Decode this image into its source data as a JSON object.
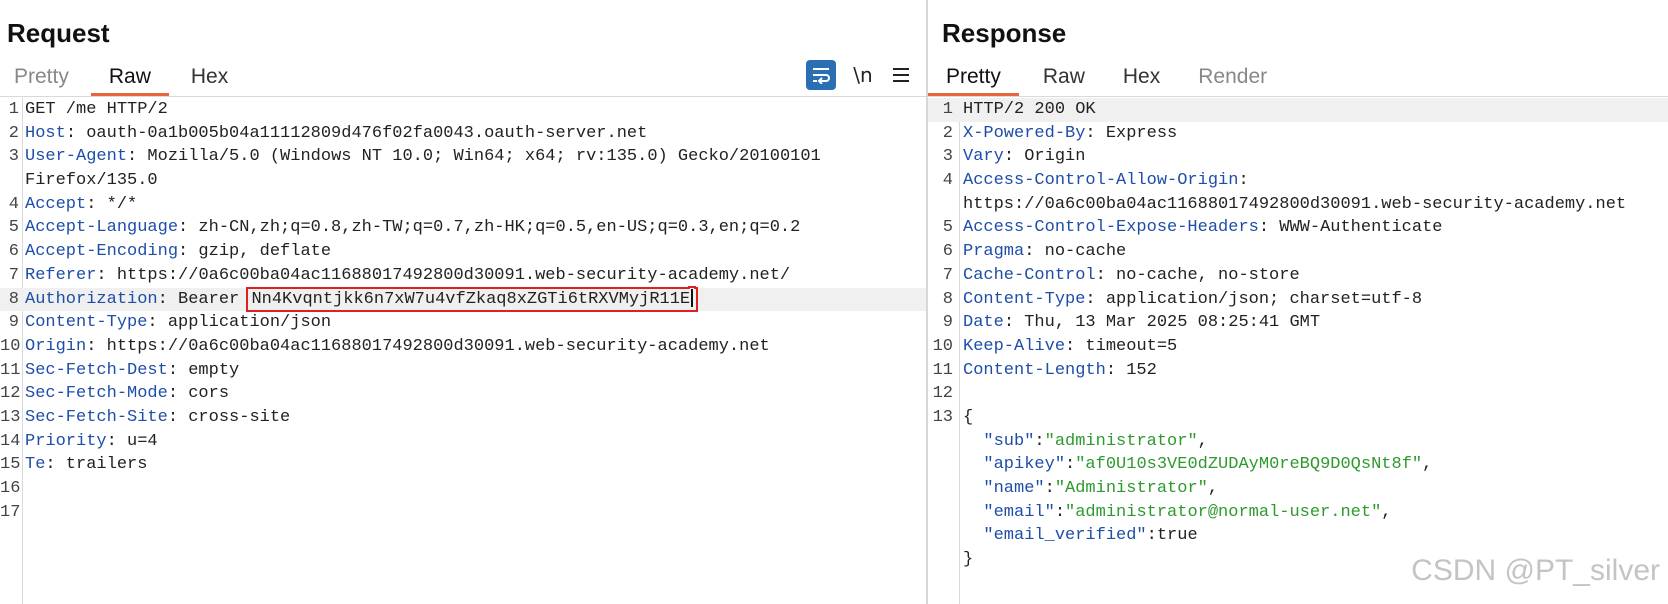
{
  "request": {
    "title": "Request",
    "tabs": [
      {
        "label": "Pretty",
        "active": false
      },
      {
        "label": "Raw",
        "active": true
      },
      {
        "label": "Hex",
        "active": false
      }
    ],
    "toolbar": {
      "wrap_icon": "word-wrap-icon",
      "newline_label": "\\n",
      "menu_icon": "hamburger-menu-icon"
    },
    "lines": [
      {
        "n": "1",
        "parts": [
          {
            "t": "GET /me HTTP/2",
            "c": "hval"
          }
        ]
      },
      {
        "n": "2",
        "parts": [
          {
            "t": "Host",
            "c": "hname"
          },
          {
            "t": ": oauth-0a1b005b04a11112809d476f02fa0043.oauth-server.net",
            "c": "hval"
          }
        ]
      },
      {
        "n": "3",
        "parts": [
          {
            "t": "User-Agent",
            "c": "hname"
          },
          {
            "t": ": Mozilla/5.0 (Windows NT 10.0; Win64; x64; rv:135.0) Gecko/20100101",
            "c": "hval"
          }
        ]
      },
      {
        "n": "",
        "parts": [
          {
            "t": "Firefox/135.0",
            "c": "hval"
          }
        ]
      },
      {
        "n": "4",
        "parts": [
          {
            "t": "Accept",
            "c": "hname"
          },
          {
            "t": ": */*",
            "c": "hval"
          }
        ]
      },
      {
        "n": "5",
        "parts": [
          {
            "t": "Accept-Language",
            "c": "hname"
          },
          {
            "t": ": zh-CN,zh;q=0.8,zh-TW;q=0.7,zh-HK;q=0.5,en-US;q=0.3,en;q=0.2",
            "c": "hval"
          }
        ]
      },
      {
        "n": "6",
        "parts": [
          {
            "t": "Accept-Encoding",
            "c": "hname"
          },
          {
            "t": ": gzip, deflate",
            "c": "hval"
          }
        ]
      },
      {
        "n": "7",
        "parts": [
          {
            "t": "Referer",
            "c": "hname"
          },
          {
            "t": ": https://0a6c00ba04ac11688017492800d30091.web-security-academy.net/",
            "c": "hval"
          }
        ]
      },
      {
        "n": "8",
        "highlight": true,
        "parts": [
          {
            "t": "Authorization",
            "c": "hname"
          },
          {
            "t": ": Bearer ",
            "c": "hval"
          },
          {
            "t": "Nn4Kvqntjkk6n7xW7u4vfZkaq8xZGTi6tRXVMyjR11E",
            "c": "hval boxed",
            "cursor": true
          }
        ]
      },
      {
        "n": "9",
        "parts": [
          {
            "t": "Content-Type",
            "c": "hname"
          },
          {
            "t": ": application/json",
            "c": "hval"
          }
        ]
      },
      {
        "n": "10",
        "parts": [
          {
            "t": "Origin",
            "c": "hname"
          },
          {
            "t": ": https://0a6c00ba04ac11688017492800d30091.web-security-academy.net",
            "c": "hval"
          }
        ]
      },
      {
        "n": "11",
        "parts": [
          {
            "t": "Sec-Fetch-Dest",
            "c": "hname"
          },
          {
            "t": ": empty",
            "c": "hval"
          }
        ]
      },
      {
        "n": "12",
        "parts": [
          {
            "t": "Sec-Fetch-Mode",
            "c": "hname"
          },
          {
            "t": ": cors",
            "c": "hval"
          }
        ]
      },
      {
        "n": "13",
        "parts": [
          {
            "t": "Sec-Fetch-Site",
            "c": "hname"
          },
          {
            "t": ": cross-site",
            "c": "hval"
          }
        ]
      },
      {
        "n": "14",
        "parts": [
          {
            "t": "Priority",
            "c": "hname"
          },
          {
            "t": ": u=4",
            "c": "hval"
          }
        ]
      },
      {
        "n": "15",
        "parts": [
          {
            "t": "Te",
            "c": "hname"
          },
          {
            "t": ": trailers",
            "c": "hval"
          }
        ]
      },
      {
        "n": "16",
        "parts": []
      },
      {
        "n": "17",
        "parts": []
      }
    ]
  },
  "response": {
    "title": "Response",
    "tabs": [
      {
        "label": "Pretty",
        "active": true
      },
      {
        "label": "Raw",
        "active": false
      },
      {
        "label": "Hex",
        "active": false
      },
      {
        "label": "Render",
        "active": false,
        "muted": true
      }
    ],
    "lines": [
      {
        "n": "1",
        "highlight": true,
        "parts": [
          {
            "t": "HTTP/2 200 OK",
            "c": "hval"
          }
        ]
      },
      {
        "n": "2",
        "parts": [
          {
            "t": "X-Powered-By",
            "c": "hname"
          },
          {
            "t": ": Express",
            "c": "hval"
          }
        ]
      },
      {
        "n": "3",
        "parts": [
          {
            "t": "Vary",
            "c": "hname"
          },
          {
            "t": ": Origin",
            "c": "hval"
          }
        ]
      },
      {
        "n": "4",
        "parts": [
          {
            "t": "Access-Control-Allow-Origin",
            "c": "hname"
          },
          {
            "t": ":",
            "c": "hval"
          }
        ]
      },
      {
        "n": "",
        "parts": [
          {
            "t": "https://0a6c00ba04ac11688017492800d30091.web-security-academy.net",
            "c": "hval"
          }
        ]
      },
      {
        "n": "5",
        "parts": [
          {
            "t": "Access-Control-Expose-Headers",
            "c": "hname"
          },
          {
            "t": ": WWW-Authenticate",
            "c": "hval"
          }
        ]
      },
      {
        "n": "6",
        "parts": [
          {
            "t": "Pragma",
            "c": "hname"
          },
          {
            "t": ": no-cache",
            "c": "hval"
          }
        ]
      },
      {
        "n": "7",
        "parts": [
          {
            "t": "Cache-Control",
            "c": "hname"
          },
          {
            "t": ": no-cache, no-store",
            "c": "hval"
          }
        ]
      },
      {
        "n": "8",
        "parts": [
          {
            "t": "Content-Type",
            "c": "hname"
          },
          {
            "t": ": application/json; charset=utf-8",
            "c": "hval"
          }
        ]
      },
      {
        "n": "9",
        "parts": [
          {
            "t": "Date",
            "c": "hname"
          },
          {
            "t": ": Thu, 13 Mar 2025 08:25:41 GMT",
            "c": "hval"
          }
        ]
      },
      {
        "n": "10",
        "parts": [
          {
            "t": "Keep-Alive",
            "c": "hname"
          },
          {
            "t": ": timeout=5",
            "c": "hval"
          }
        ]
      },
      {
        "n": "11",
        "parts": [
          {
            "t": "Content-Length",
            "c": "hname"
          },
          {
            "t": ": 152",
            "c": "hval"
          }
        ]
      },
      {
        "n": "12",
        "parts": []
      },
      {
        "n": "13",
        "parts": [
          {
            "t": "{",
            "c": "jplain"
          }
        ]
      },
      {
        "n": "",
        "parts": [
          {
            "t": "  \"sub\"",
            "c": "jkey"
          },
          {
            "t": ":",
            "c": "jplain"
          },
          {
            "t": "\"administrator\"",
            "c": "jstr"
          },
          {
            "t": ",",
            "c": "jplain"
          }
        ]
      },
      {
        "n": "",
        "parts": [
          {
            "t": "  \"apikey\"",
            "c": "jkey"
          },
          {
            "t": ":",
            "c": "jplain"
          },
          {
            "t": "\"af0U10s3VE0dZUDAyM0reBQ9D0QsNt8f\"",
            "c": "jstr"
          },
          {
            "t": ",",
            "c": "jplain"
          }
        ]
      },
      {
        "n": "",
        "parts": [
          {
            "t": "  \"name\"",
            "c": "jkey"
          },
          {
            "t": ":",
            "c": "jplain"
          },
          {
            "t": "\"Administrator\"",
            "c": "jstr"
          },
          {
            "t": ",",
            "c": "jplain"
          }
        ]
      },
      {
        "n": "",
        "parts": [
          {
            "t": "  \"email\"",
            "c": "jkey"
          },
          {
            "t": ":",
            "c": "jplain"
          },
          {
            "t": "\"administrator@normal-user.net\"",
            "c": "jstr"
          },
          {
            "t": ",",
            "c": "jplain"
          }
        ]
      },
      {
        "n": "",
        "parts": [
          {
            "t": "  \"email_verified\"",
            "c": "jkey"
          },
          {
            "t": ":true",
            "c": "jplain"
          }
        ]
      },
      {
        "n": "",
        "parts": [
          {
            "t": "}",
            "c": "jplain"
          }
        ]
      }
    ]
  },
  "watermark": "CSDN @PT_silver",
  "colors": {
    "accent_tab_underline": "#e8663d",
    "header_name": "#1e4ea8",
    "json_string": "#2e9a2e",
    "wrap_button_bg": "#2a6fb3",
    "selection_box": "#e02020"
  }
}
